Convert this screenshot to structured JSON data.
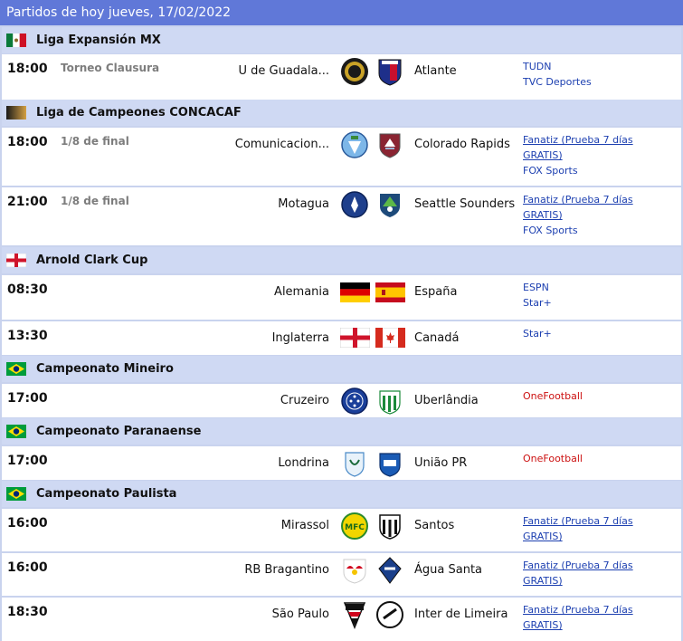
{
  "header": {
    "title": "Partidos de hoy jueves, 17/02/2022"
  },
  "colors": {
    "header_bg": "#6078d8",
    "league_bg": "#cfd9f3",
    "channel_blue": "#1c3fb0",
    "channel_red": "#cc1111",
    "round_gray": "#7d7d7d"
  },
  "leagues": [
    {
      "name": "Liga Expansión MX",
      "flag": "mexico-flag-icon"
    },
    {
      "name": "Liga de Campeones CONCACAF",
      "flag": "concacaf-icon"
    },
    {
      "name": "Arnold Clark Cup",
      "flag": "england-flag-icon"
    },
    {
      "name": "Campeonato Mineiro",
      "flag": "brazil-flag-icon"
    },
    {
      "name": "Campeonato Paranaense",
      "flag": "brazil-flag-icon"
    },
    {
      "name": "Campeonato Paulista",
      "flag": "brazil-flag-icon"
    }
  ],
  "matches": [
    {
      "time": "18:00",
      "round": "Torneo Clausura",
      "home": "U de Guadala...",
      "away": "Atlante",
      "home_logo": "leones-negros-crest-icon",
      "away_logo": "atlante-crest-icon",
      "channels": [
        "TUDN",
        "TVC Deportes"
      ]
    },
    {
      "time": "18:00",
      "round": "1/8 de final",
      "home": "Comunicacion...",
      "away": "Colorado Rapids",
      "home_logo": "comunicaciones-crest-icon",
      "away_logo": "colorado-rapids-crest-icon",
      "channels": [
        "Fanatiz (Prueba 7 días",
        "GRATIS)",
        "FOX Sports"
      ]
    },
    {
      "time": "21:00",
      "round": "1/8 de final",
      "home": "Motagua",
      "away": "Seattle Sounders",
      "home_logo": "motagua-crest-icon",
      "away_logo": "seattle-sounders-crest-icon",
      "channels": [
        "Fanatiz (Prueba 7 días",
        "GRATIS)",
        "FOX Sports"
      ]
    },
    {
      "time": "08:30",
      "round": "",
      "home": "Alemania",
      "away": "España",
      "home_logo": "germany-flag-icon",
      "away_logo": "spain-flag-icon",
      "channels": [
        "ESPN",
        "Star+"
      ]
    },
    {
      "time": "13:30",
      "round": "",
      "home": "Inglaterra",
      "away": "Canadá",
      "home_logo": "england-flag-icon",
      "away_logo": "canada-flag-icon",
      "channels": [
        "Star+"
      ]
    },
    {
      "time": "17:00",
      "round": "",
      "home": "Cruzeiro",
      "away": "Uberlândia",
      "home_logo": "cruzeiro-crest-icon",
      "away_logo": "uberlandia-crest-icon",
      "channels": [
        "OneFootball"
      ]
    },
    {
      "time": "17:00",
      "round": "",
      "home": "Londrina",
      "away": "União PR",
      "home_logo": "londrina-crest-icon",
      "away_logo": "uniao-pr-crest-icon",
      "channels": [
        "OneFootball"
      ]
    },
    {
      "time": "16:00",
      "round": "",
      "home": "Mirassol",
      "away": "Santos",
      "home_logo": "mirassol-crest-icon",
      "away_logo": "santos-crest-icon",
      "channels": [
        "Fanatiz (Prueba 7 días",
        "GRATIS)"
      ]
    },
    {
      "time": "16:00",
      "round": "",
      "home": "RB Bragantino",
      "away": "Água Santa",
      "home_logo": "rb-bragantino-crest-icon",
      "away_logo": "agua-santa-crest-icon",
      "channels": [
        "Fanatiz (Prueba 7 días",
        "GRATIS)"
      ]
    },
    {
      "time": "18:30",
      "round": "",
      "home": "São Paulo",
      "away": "Inter de Limeira",
      "home_logo": "sao-paulo-crest-icon",
      "away_logo": "inter-de-limeira-crest-icon",
      "channels": [
        "Fanatiz (Prueba 7 días",
        "GRATIS)"
      ]
    }
  ]
}
